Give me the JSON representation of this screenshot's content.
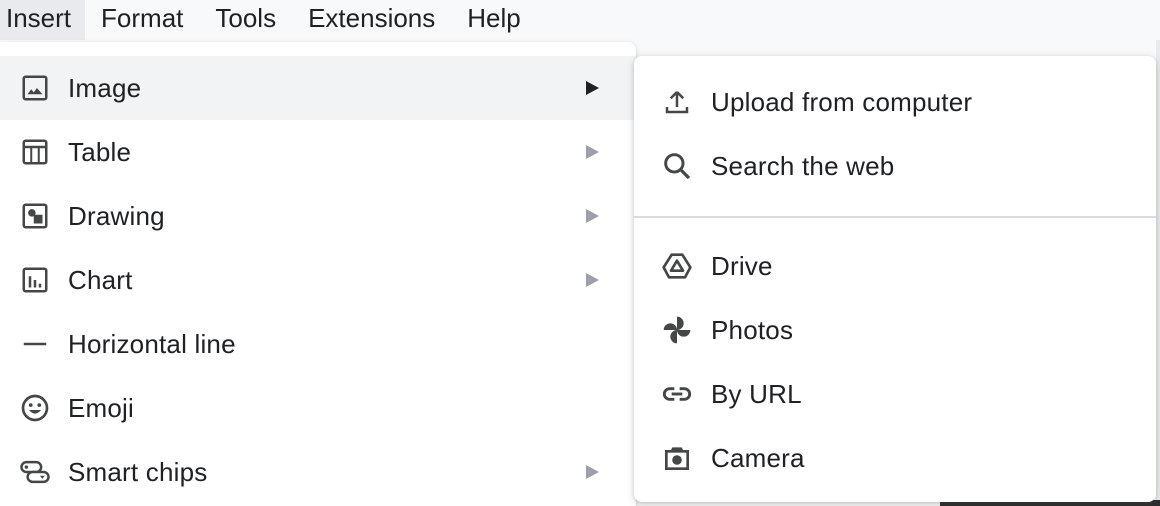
{
  "menubar": {
    "items": [
      {
        "label": "Insert",
        "active": true
      },
      {
        "label": "Format",
        "active": false
      },
      {
        "label": "Tools",
        "active": false
      },
      {
        "label": "Extensions",
        "active": false
      },
      {
        "label": "Help",
        "active": false
      }
    ]
  },
  "insert_menu": {
    "items": [
      {
        "label": "Image",
        "icon": "image-icon",
        "has_submenu": true,
        "highlighted": true
      },
      {
        "label": "Table",
        "icon": "table-icon",
        "has_submenu": true
      },
      {
        "label": "Drawing",
        "icon": "drawing-icon",
        "has_submenu": true
      },
      {
        "label": "Chart",
        "icon": "chart-icon",
        "has_submenu": true
      },
      {
        "label": "Horizontal line",
        "icon": "horizontal-line-icon",
        "has_submenu": false
      },
      {
        "label": "Emoji",
        "icon": "emoji-icon",
        "has_submenu": false
      },
      {
        "label": "Smart chips",
        "icon": "smart-chips-icon",
        "has_submenu": true
      }
    ]
  },
  "image_submenu": {
    "group1": [
      {
        "label": "Upload from computer",
        "icon": "upload-icon"
      },
      {
        "label": "Search the web",
        "icon": "search-icon"
      }
    ],
    "group2": [
      {
        "label": "Drive",
        "icon": "drive-icon"
      },
      {
        "label": "Photos",
        "icon": "photos-icon"
      },
      {
        "label": "By URL",
        "icon": "link-icon"
      },
      {
        "label": "Camera",
        "icon": "camera-icon"
      }
    ]
  },
  "colors": {
    "icon": "#444746",
    "text": "#202124",
    "highlight": "#f1f3f4",
    "arrow_inactive": "#9aa0a6"
  }
}
